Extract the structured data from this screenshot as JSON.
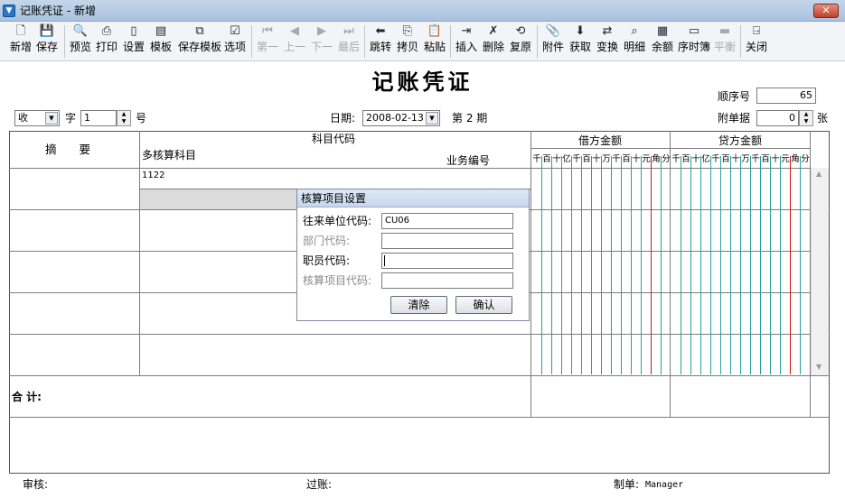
{
  "window": {
    "title": "记账凭证 - 新增",
    "close_label": "✕"
  },
  "toolbar": [
    {
      "name": "new",
      "label": "新增",
      "icon": "new-file-icon",
      "glyph": "🗋",
      "enabled": true
    },
    {
      "name": "save",
      "label": "保存",
      "icon": "save-icon",
      "glyph": "💾",
      "enabled": true
    },
    {
      "name": "preview",
      "label": "预览",
      "icon": "preview-icon",
      "glyph": "🔍",
      "enabled": true
    },
    {
      "name": "print",
      "label": "打印",
      "icon": "printer-icon",
      "glyph": "⎙",
      "enabled": true
    },
    {
      "name": "settings",
      "label": "设置",
      "icon": "page-settings-icon",
      "glyph": "▯",
      "enabled": true
    },
    {
      "name": "template",
      "label": "模板",
      "icon": "template-icon",
      "glyph": "▤",
      "enabled": true
    },
    {
      "name": "save-template",
      "label": "保存模板",
      "icon": "save-template-icon",
      "glyph": "⧉",
      "enabled": true
    },
    {
      "name": "options",
      "label": "选项",
      "icon": "options-icon",
      "glyph": "☑",
      "enabled": true
    },
    {
      "name": "first",
      "label": "第一",
      "icon": "first-record-icon",
      "glyph": "⏮",
      "enabled": false
    },
    {
      "name": "prev",
      "label": "上一",
      "icon": "previous-record-icon",
      "glyph": "◀",
      "enabled": false
    },
    {
      "name": "next",
      "label": "下一",
      "icon": "next-record-icon",
      "glyph": "▶",
      "enabled": false
    },
    {
      "name": "last",
      "label": "最后",
      "icon": "last-record-icon",
      "glyph": "⏭",
      "enabled": false
    },
    {
      "name": "jump",
      "label": "跳转",
      "icon": "jump-arrow-icon",
      "glyph": "⬅",
      "enabled": true
    },
    {
      "name": "copy",
      "label": "拷贝",
      "icon": "copy-icon",
      "glyph": "⎘",
      "enabled": true
    },
    {
      "name": "paste",
      "label": "粘贴",
      "icon": "paste-icon",
      "glyph": "📋",
      "enabled": true
    },
    {
      "name": "insert",
      "label": "插入",
      "icon": "insert-row-icon",
      "glyph": "⇥",
      "enabled": true
    },
    {
      "name": "delete",
      "label": "删除",
      "icon": "delete-row-icon",
      "glyph": "✗",
      "enabled": true
    },
    {
      "name": "restore",
      "label": "复原",
      "icon": "restore-icon",
      "glyph": "⟲",
      "enabled": true
    },
    {
      "name": "attachment",
      "label": "附件",
      "icon": "attachment-icon",
      "glyph": "📎",
      "enabled": true
    },
    {
      "name": "fetch",
      "label": "获取",
      "icon": "fetch-icon",
      "glyph": "⬇",
      "enabled": true
    },
    {
      "name": "convert",
      "label": "变换",
      "icon": "convert-icon",
      "glyph": "⇄",
      "enabled": true
    },
    {
      "name": "detail",
      "label": "明细",
      "icon": "binoculars-icon",
      "glyph": "⌕",
      "enabled": true
    },
    {
      "name": "balance",
      "label": "余额",
      "icon": "balance-grid-icon",
      "glyph": "▦",
      "enabled": true
    },
    {
      "name": "journal",
      "label": "序时簿",
      "icon": "journal-icon",
      "glyph": "▭",
      "enabled": true
    },
    {
      "name": "balance-check",
      "label": "平衡",
      "icon": "balance-icon",
      "glyph": "▬",
      "enabled": false
    },
    {
      "name": "close",
      "label": "关闭",
      "icon": "exit-door-icon",
      "glyph": "⍈",
      "enabled": true
    }
  ],
  "heading": "记账凭证",
  "header": {
    "seq_label": "顺序号",
    "seq_value": "65",
    "attach_label": "附单据",
    "attach_value": "0",
    "attach_unit": "张",
    "type_value": "收",
    "zi_label": "字",
    "number_value": "1",
    "hao_label": "号",
    "date_label": "日期:",
    "date_value": "2008-02-13",
    "period_label": "第 2 期"
  },
  "grid": {
    "summary_header": "摘　　要",
    "account_header": "科目代码",
    "multi_account_header": "多核算科目",
    "business_no_header": "业务编号",
    "debit_header": "借方金额",
    "credit_header": "贷方金额",
    "digit_units": [
      "千",
      "百",
      "十",
      "亿",
      "千",
      "百",
      "十",
      "万",
      "千",
      "百",
      "十",
      "元",
      "角",
      "分"
    ],
    "rows": [
      {
        "summary": "",
        "account": "1122"
      },
      {
        "summary": "",
        "account": ""
      },
      {
        "summary": "",
        "account": ""
      },
      {
        "summary": "",
        "account": ""
      },
      {
        "summary": "",
        "account": ""
      }
    ],
    "total_label": "合 计:"
  },
  "popup": {
    "title": "核算项目设置",
    "fields": [
      {
        "label": "往来单位代码:",
        "value": "CU06",
        "enabled": true
      },
      {
        "label": "部门代码:",
        "value": "",
        "enabled": false
      },
      {
        "label": "职员代码:",
        "value": "",
        "enabled": true
      },
      {
        "label": "核算项目代码:",
        "value": "",
        "enabled": false
      }
    ],
    "clear_label": "清除",
    "confirm_label": "确认"
  },
  "footer": {
    "review_label": "审核:",
    "review_value": "",
    "post_label": "过账:",
    "post_value": "",
    "maker_label": "制单:",
    "maker_value": "Manager"
  },
  "colors": {
    "teal_line": "#29a19a",
    "red_line": "#d51818"
  }
}
